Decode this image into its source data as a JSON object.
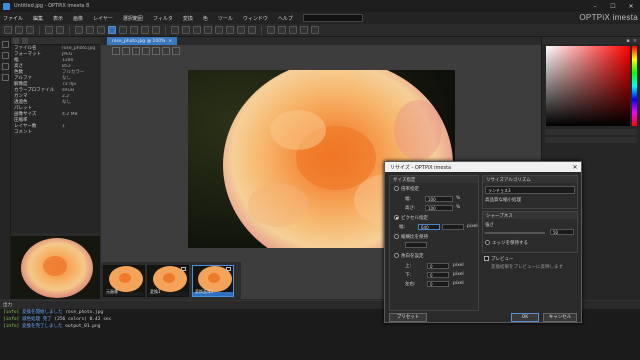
{
  "window": {
    "title": "Untitled.jpg - OPTPiX imesta 8",
    "controls": [
      "–",
      "☐",
      "✕"
    ]
  },
  "brand": "OPTPiX imesta",
  "menu": [
    "ファイル",
    "編集",
    "表示",
    "画像",
    "レイヤー",
    "選択範囲",
    "フィルタ",
    "変換",
    "色",
    "ツール",
    "ウィンドウ",
    "ヘルプ"
  ],
  "document": {
    "tab_label": "rose_photo.jpg @ 100%",
    "close": "×"
  },
  "properties": {
    "rows": [
      {
        "k": "ファイル名",
        "v": "rose_photo.jpg"
      },
      {
        "k": "フォーマット",
        "v": "JPEG"
      },
      {
        "k": "幅",
        "v": "1280"
      },
      {
        "k": "高さ",
        "v": "853"
      },
      {
        "k": "色数",
        "v": "フルカラー"
      },
      {
        "k": "アルファ",
        "v": "なし"
      },
      {
        "k": "解像度",
        "v": "72 dpi"
      },
      {
        "k": "カラープロファイル",
        "v": "sRGB"
      },
      {
        "k": "ガンマ",
        "v": "2.2"
      },
      {
        "k": "透過色",
        "v": "なし"
      },
      {
        "k": "パレット",
        "v": ""
      },
      {
        "k": "画像サイズ",
        "v": "4.2 MB"
      },
      {
        "k": "圧縮率",
        "v": ""
      },
      {
        "k": "レイヤー数",
        "v": "1"
      },
      {
        "k": "コメント",
        "v": ""
      }
    ]
  },
  "filmstrip": [
    {
      "caption": "元画像",
      "selected": false
    },
    {
      "caption": "変換1",
      "selected": false
    },
    {
      "caption": "変換画像2",
      "selected": true
    }
  ],
  "console": {
    "header": "出力",
    "lines": [
      {
        "a": "[info]",
        "b": "変換を開始しました",
        "c": "rose_photo.jpg"
      },
      {
        "a": "[info]",
        "b": "減色処理 完了",
        "c": "(256 colors) 0.42 sec"
      },
      {
        "a": "[info]",
        "b": "変換を完了しました",
        "c": "output_01.png"
      }
    ]
  },
  "dialog": {
    "title": "リサイズ - OPTPiX imesta",
    "close": "✕",
    "left_group": {
      "header": "サイズ指定",
      "scale_label": "倍率指定",
      "w_label": "幅:",
      "w_value": "100",
      "w_unit": "%",
      "h_label": "高さ:",
      "h_value": "100",
      "h_unit": "%",
      "pixel_label": "ピクセル指定",
      "pw_label": "幅:",
      "pw_value": "640",
      "pw_unit": "pixel",
      "keep_label": "縦横比を保持",
      "custom_label": "余白を設定",
      "top_label": "上:",
      "top_value": "0",
      "bottom_label": "下:",
      "bottom_value": "0",
      "lr_label": "左右:",
      "lr_value": "0",
      "unit": "pixel"
    },
    "right_group": {
      "header1": "リサイズアルゴリズム",
      "algo_value": "ランチョス3",
      "algo_desc": "高品質な縮小処理",
      "header2": "シャープネス",
      "sharp_label": "強さ",
      "sharp_value": "50",
      "check_label": "エッジを保持する",
      "header3": "プレビュー",
      "preview_desc": "変換結果をプレビューに反映します"
    },
    "buttons": {
      "preset": "プリセット",
      "ok": "OK",
      "cancel": "キャンセル"
    }
  }
}
